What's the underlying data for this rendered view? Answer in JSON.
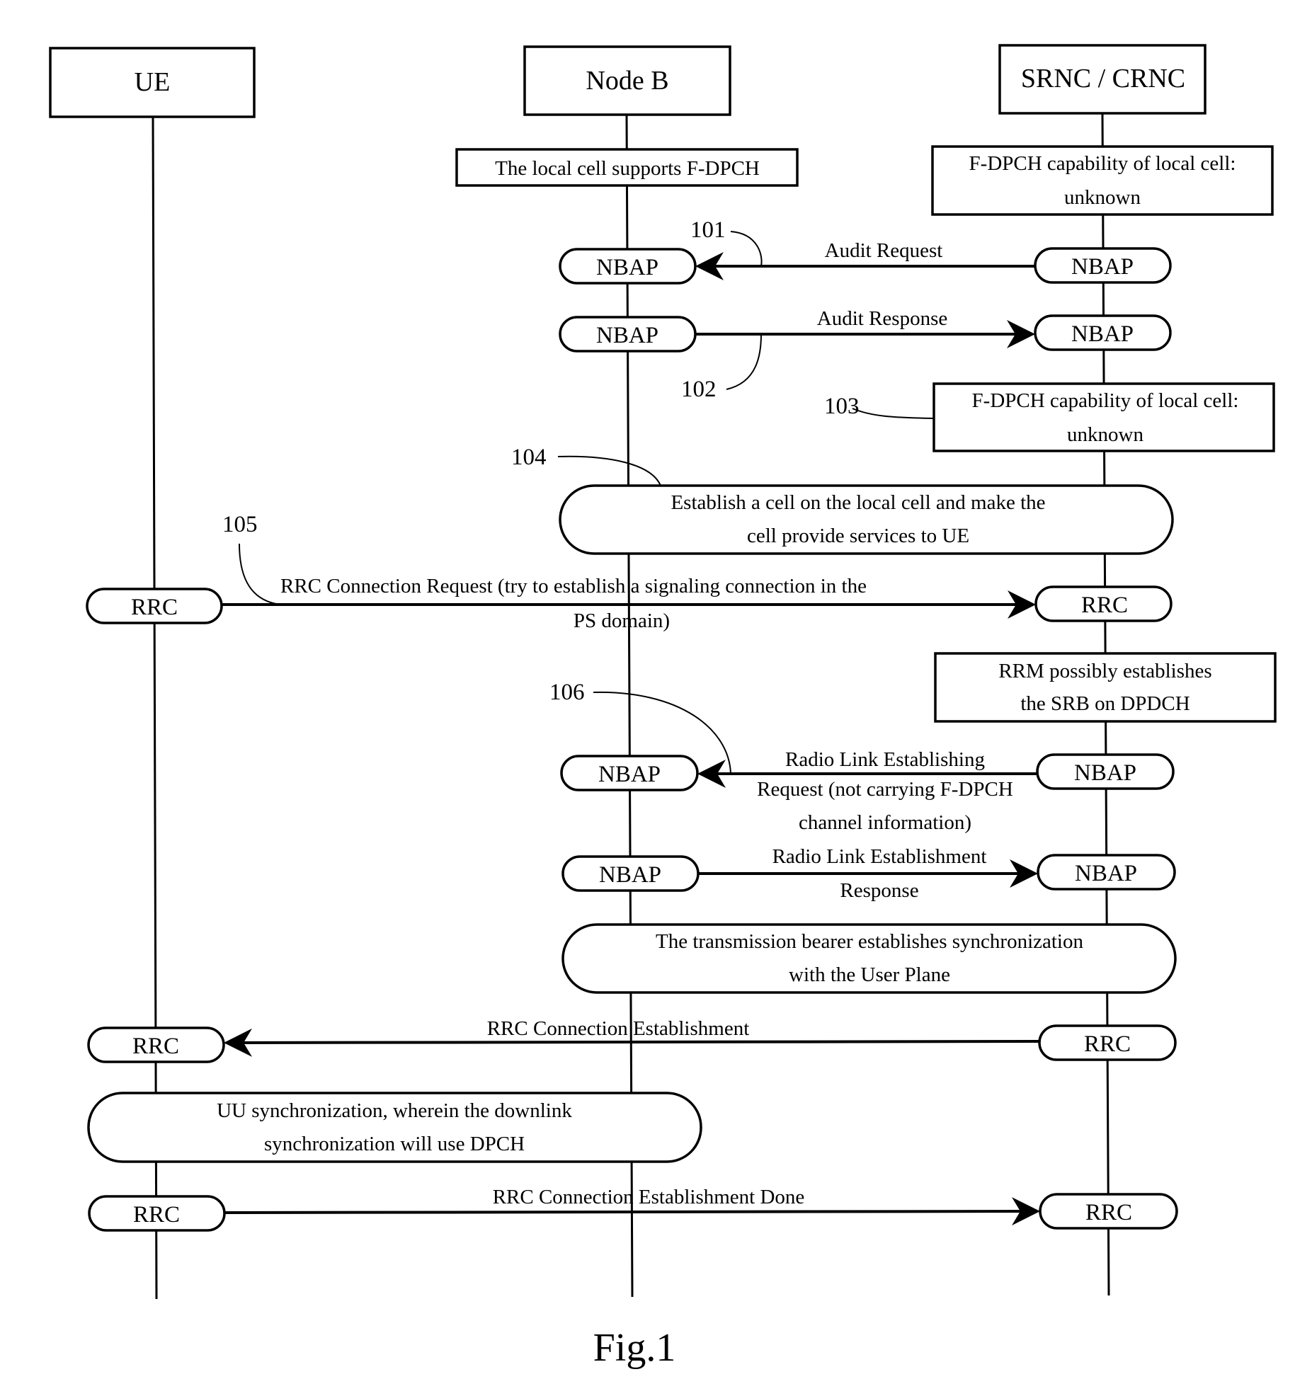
{
  "entities": {
    "ue": "UE",
    "nodeb": "Node B",
    "srnc": "SRNC / CRNC"
  },
  "notes": {
    "nodeb_supports": "The local cell supports F-DPCH",
    "srnc_cap1_line1": "F-DPCH capability of local cell:",
    "srnc_cap1_line2": "unknown",
    "srnc_cap2_line1": "F-DPCH capability of local cell:",
    "srnc_cap2_line2": "unknown",
    "establish_cell_line1": "Establish a cell on the local cell and make the",
    "establish_cell_line2": "cell provide services to UE",
    "rrm_line1": "RRM possibly establishes",
    "rrm_line2": "the SRB on DPDCH",
    "transport_sync_line1": "The transmission bearer establishes synchronization",
    "transport_sync_line2": "with the User Plane",
    "uu_sync_line1": "UU synchronization, wherein the downlink",
    "uu_sync_line2": "synchronization will use DPCH"
  },
  "protocols": {
    "nbap": "NBAP",
    "rrc": "RRC"
  },
  "messages": {
    "audit_request": "Audit Request",
    "audit_response": "Audit Response",
    "rrc_conn_req_line1": "RRC Connection Request (try to establish a signaling connection in the",
    "rrc_conn_req_line2": "PS domain)",
    "rl_setup_req_line1": "Radio Link Establishing",
    "rl_setup_req_line2": "Request (not carrying F-DPCH",
    "rl_setup_req_line3": "channel information)",
    "rl_setup_resp_line1": "Radio Link Establishment",
    "rl_setup_resp_line2": "Response",
    "rrc_conn_setup": "RRC Connection Establishment",
    "rrc_conn_setup_done": "RRC Connection Establishment Done"
  },
  "step_numbers": {
    "s101": "101",
    "s102": "102",
    "s103": "103",
    "s104": "104",
    "s105": "105",
    "s106": "106"
  },
  "caption": "Fig.1"
}
